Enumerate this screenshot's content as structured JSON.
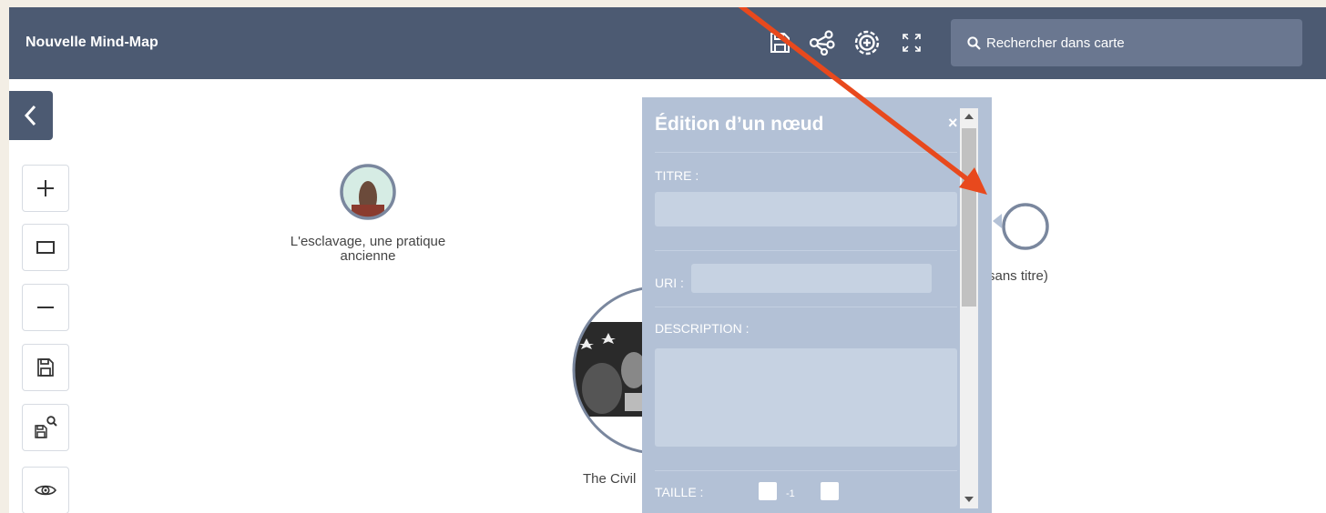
{
  "header": {
    "title": "Nouvelle Mind-Map",
    "search_placeholder": "Rechercher dans carte"
  },
  "map": {
    "nodes": [
      {
        "id": "slavery",
        "label_line1": "L'esclavage, une pratique",
        "label_line2": "ancienne"
      },
      {
        "id": "untitled",
        "label": "(sans titre)"
      },
      {
        "id": "civil",
        "label": "The Civil"
      }
    ]
  },
  "edit_panel": {
    "title": "Édition d’un nœud",
    "close": "×",
    "title_label": "TITRE :",
    "title_value": "",
    "uri_label": "URI :",
    "uri_value": "",
    "description_label": "DESCRIPTION :",
    "description_value": "",
    "size_label": "TAILLE :",
    "size_value": "-1"
  },
  "toolbar_icons": [
    "save-icon",
    "share-icon",
    "add-node-icon",
    "fullscreen-icon"
  ],
  "sidebar_icons": [
    "back-icon",
    "zoom-in-icon",
    "fit-icon",
    "zoom-out-icon",
    "save-icon",
    "save-search-icon",
    "view-icon"
  ],
  "colors": {
    "header": "#4c5a72",
    "panel": "#b3c1d6",
    "node_ring": "#7a879e",
    "arrow": "#e8491d"
  }
}
